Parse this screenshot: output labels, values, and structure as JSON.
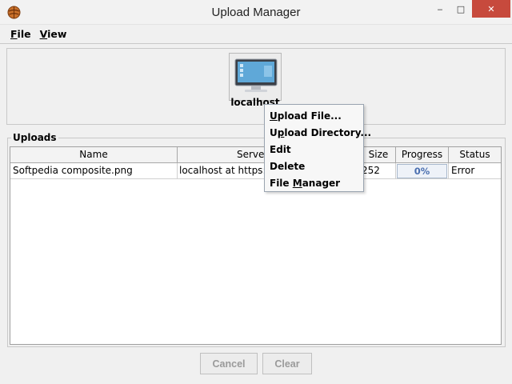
{
  "window": {
    "title": "Upload Manager",
    "minimize": "‒",
    "maximize": "□",
    "close": "✕"
  },
  "menubar": {
    "file": {
      "accel": "F",
      "rest": "ile"
    },
    "view": {
      "accel": "V",
      "rest": "iew"
    }
  },
  "server": {
    "label": "localhost"
  },
  "uploads": {
    "title": "Uploads",
    "columns": [
      "Name",
      "Server",
      "Size",
      "Progress",
      "Status"
    ],
    "rows": [
      {
        "name": "Softpedia composite.png",
        "server": "localhost at https://l",
        "size": "252",
        "progress": "0%",
        "status": "Error"
      }
    ]
  },
  "buttons": {
    "cancel": "Cancel",
    "clear": "Clear"
  },
  "context_menu": {
    "upload_file": {
      "accel": "U",
      "rest": "pload File..."
    },
    "upload_directory": {
      "pre": "U",
      "accel": "p",
      "rest": "load Directory..."
    },
    "edit": "Edit",
    "delete": "Delete",
    "file_manager": {
      "pre": "File ",
      "accel": "M",
      "rest": "anager"
    }
  },
  "colors": {
    "accent": "#4a6fb0",
    "close_button": "#c74a3d",
    "background": "#f0f0f0"
  }
}
